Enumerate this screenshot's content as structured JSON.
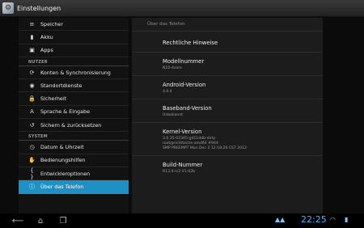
{
  "actionbar": {
    "title": "Einstellungen",
    "icon": "settings-icon"
  },
  "left": {
    "items_top": [
      {
        "label": "Speicher",
        "icon": "storage-icon",
        "glyph": "≡"
      },
      {
        "label": "Akku",
        "icon": "battery-icon",
        "glyph": "▮"
      },
      {
        "label": "Apps",
        "icon": "apps-icon",
        "glyph": "▣"
      }
    ],
    "section_nutzer": "NUTZER",
    "items_nutzer": [
      {
        "label": "Konten & Synchronisierung",
        "icon": "sync-icon",
        "glyph": "⟳"
      },
      {
        "label": "Standortdienste",
        "icon": "location-icon",
        "glyph": "◉"
      },
      {
        "label": "Sicherheit",
        "icon": "lock-icon",
        "glyph": "🔒"
      },
      {
        "label": "Sprache & Eingabe",
        "icon": "language-icon",
        "glyph": "A"
      },
      {
        "label": "Sichern & zurücksetzen",
        "icon": "backup-icon",
        "glyph": "↺"
      }
    ],
    "section_system": "SYSTEM",
    "items_system": [
      {
        "label": "Datum & Uhrzeit",
        "icon": "clock-icon",
        "glyph": "◷"
      },
      {
        "label": "Bedienungshilfen",
        "icon": "accessibility-icon",
        "glyph": "✋"
      },
      {
        "label": "Entwickleroptionen",
        "icon": "developer-icon",
        "glyph": "{ }"
      },
      {
        "label": "Über das Telefon",
        "icon": "info-icon",
        "glyph": "ⓘ"
      }
    ]
  },
  "right": {
    "header": "Über das Telefon",
    "legal": "Rechtliche Hinweise",
    "model_title": "Modellnummer",
    "model_value": "N10-4core",
    "android_title": "Android-Version",
    "android_value": "4.0.4",
    "baseband_title": "Baseband-Version",
    "baseband_value": "Unbekannt",
    "kernel_title": "Kernel-Version",
    "kernel_line1": "3.0.35-02345-g411ddb-dirty",
    "kernel_line2": "root@richtteche-amd64 #944",
    "kernel_line3": "SMP PREEMPT Mon Dec 3 12:18:26 CST 2012",
    "build_title": "Build-Nummer",
    "build_value": "R13.4-rc2 V1.62b"
  },
  "sysbar": {
    "back": "⟵",
    "home": "⌂",
    "recent": "❐",
    "clock": "22:25",
    "colors": {
      "accent": "#1f8fc4",
      "clock": "#49b6ff"
    }
  }
}
